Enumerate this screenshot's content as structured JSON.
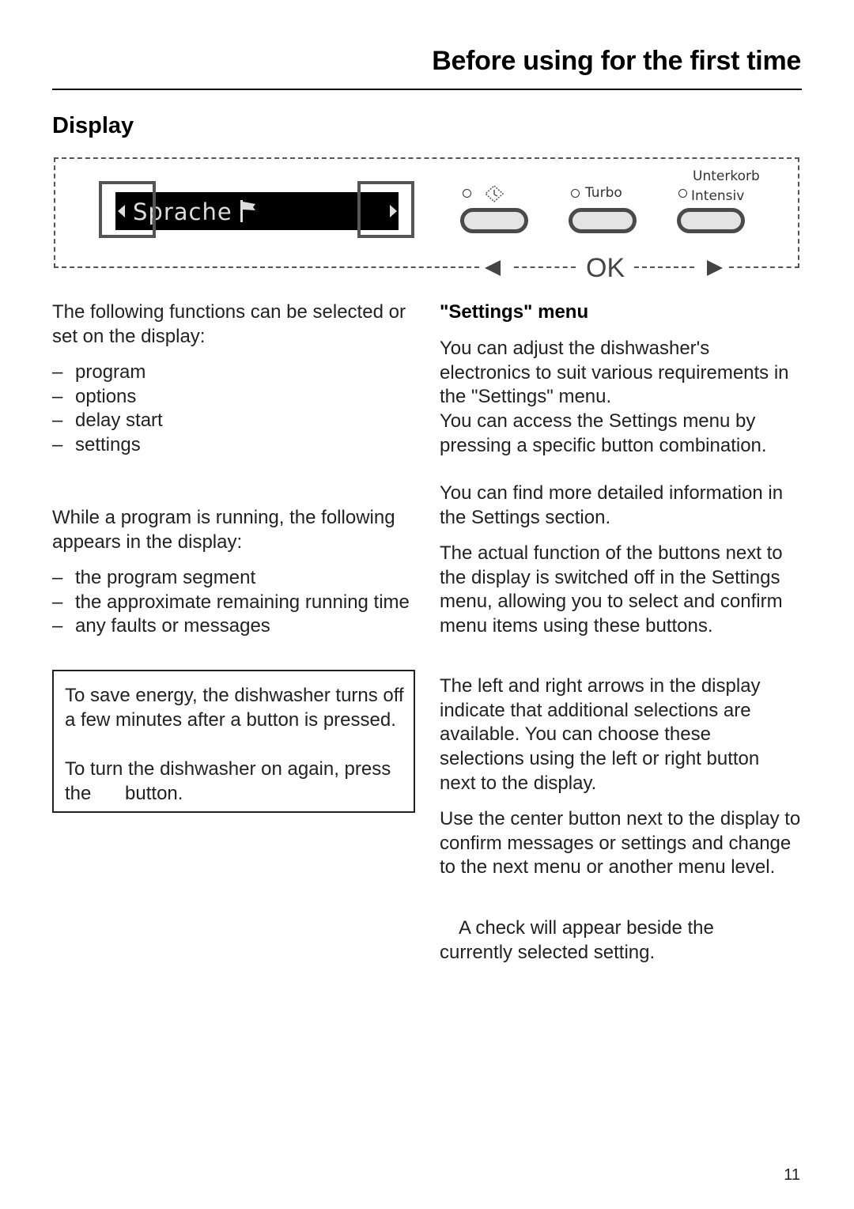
{
  "header": {
    "title": "Before using for the first time"
  },
  "section": {
    "title": "Display"
  },
  "panel": {
    "display_text": "Sprache",
    "display_icon": "flag-icon",
    "buttons": [
      {
        "label": "",
        "icon": "delay-start-icon"
      },
      {
        "label": "Turbo"
      },
      {
        "label_top": "Unterkorb",
        "label": "Intensiv"
      }
    ],
    "ok_label": "OK"
  },
  "left": {
    "intro": "The following functions can be selected or set on the display:",
    "functions": [
      "program",
      "options",
      "delay start",
      "settings"
    ],
    "running_intro": "While a program is running, the following appears in the display:",
    "running_items": [
      "the program segment",
      "the approximate remaining running time",
      "any faults or messages"
    ],
    "note": {
      "line1": "To save energy, the dishwasher turns off a few minutes after a button is pressed.",
      "line2": "To turn the dishwasher on again, press the   button."
    }
  },
  "right": {
    "heading": "\"Settings\" menu",
    "p1": "You can adjust the dishwasher's electronics to suit various requirements in the \"Settings\" menu.",
    "p1b": "You can access the Settings menu by pressing a specific button combination.",
    "p2": "You can find more detailed information in the Settings section.",
    "p3": "The actual function of the buttons next to the display is switched off in the Settings menu, allowing you to select and confirm menu items using these buttons.",
    "p4": "The left and right arrows in the display indicate that additional selections are available. You can choose these selections using the left or right button next to the display.",
    "p5": "Use the center button next to the display to confirm messages or settings and change to the next menu or another menu level.",
    "p6": " A check will appear beside the currently selected setting."
  },
  "page_number": "11"
}
